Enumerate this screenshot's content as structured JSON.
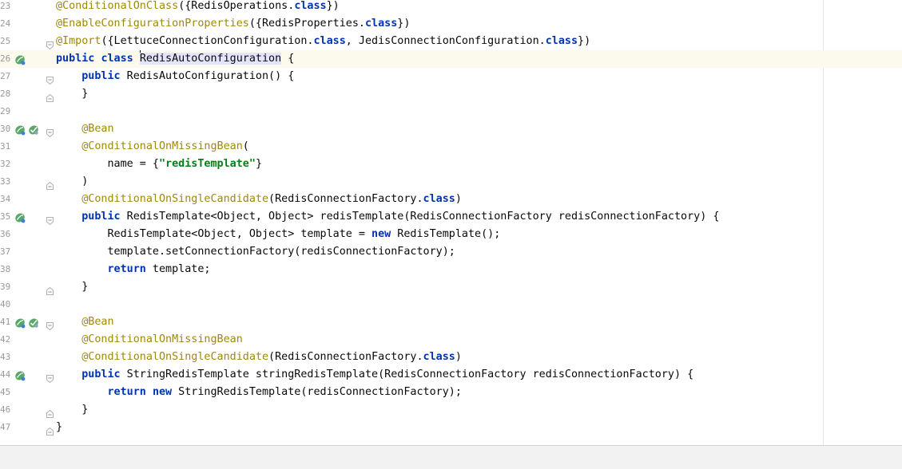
{
  "editor": {
    "lines": [
      {
        "number": "23",
        "segments": [
          [
            "annot",
            "@ConditionalOnClass"
          ],
          [
            "",
            "({RedisOperations."
          ],
          [
            "kw",
            "class"
          ],
          [
            "",
            "})"
          ]
        ]
      },
      {
        "number": "24",
        "segments": [
          [
            "annot",
            "@EnableConfigurationProperties"
          ],
          [
            "",
            "({RedisProperties."
          ],
          [
            "kw",
            "class"
          ],
          [
            "",
            "})"
          ]
        ]
      },
      {
        "number": "25",
        "segments": [
          [
            "annot",
            "@Import"
          ],
          [
            "",
            "({LettuceConnectionConfiguration."
          ],
          [
            "kw",
            "class"
          ],
          [
            "",
            ", JedisConnectionConfiguration."
          ],
          [
            "kw",
            "class"
          ],
          [
            "",
            "})"
          ]
        ]
      },
      {
        "number": "26",
        "current": true,
        "segments": [
          [
            "kw",
            "public"
          ],
          [
            "",
            " "
          ],
          [
            "kw",
            "class"
          ],
          [
            "",
            " "
          ],
          [
            "caret",
            ""
          ],
          [
            "hl",
            "RedisAutoConfiguration"
          ],
          [
            "",
            " {"
          ]
        ]
      },
      {
        "number": "27",
        "segments": [
          [
            "",
            "    "
          ],
          [
            "kw",
            "public"
          ],
          [
            "",
            " RedisAutoConfiguration() {"
          ]
        ]
      },
      {
        "number": "28",
        "segments": [
          [
            "",
            "    }"
          ]
        ]
      },
      {
        "number": "29",
        "segments": []
      },
      {
        "number": "30",
        "segments": [
          [
            "",
            "    "
          ],
          [
            "annot",
            "@Bean"
          ]
        ]
      },
      {
        "number": "31",
        "segments": [
          [
            "",
            "    "
          ],
          [
            "annot",
            "@ConditionalOnMissingBean"
          ],
          [
            "",
            "("
          ]
        ]
      },
      {
        "number": "32",
        "segments": [
          [
            "",
            "        name = {"
          ],
          [
            "str",
            "\"redisTemplate\""
          ],
          [
            "",
            "}"
          ]
        ]
      },
      {
        "number": "33",
        "segments": [
          [
            "",
            "    )"
          ]
        ]
      },
      {
        "number": "34",
        "segments": [
          [
            "",
            "    "
          ],
          [
            "annot",
            "@ConditionalOnSingleCandidate"
          ],
          [
            "",
            "(RedisConnectionFactory."
          ],
          [
            "kw",
            "class"
          ],
          [
            "",
            ")"
          ]
        ]
      },
      {
        "number": "35",
        "segments": [
          [
            "",
            "    "
          ],
          [
            "kw",
            "public"
          ],
          [
            "",
            " RedisTemplate<Object, Object> redisTemplate(RedisConnectionFactory redisConnectionFactory) {"
          ]
        ]
      },
      {
        "number": "36",
        "segments": [
          [
            "",
            "        RedisTemplate<Object, Object> template = "
          ],
          [
            "kw",
            "new"
          ],
          [
            "",
            " RedisTemplate();"
          ]
        ]
      },
      {
        "number": "37",
        "segments": [
          [
            "",
            "        template.setConnectionFactory(redisConnectionFactory);"
          ]
        ]
      },
      {
        "number": "38",
        "segments": [
          [
            "",
            "        "
          ],
          [
            "kw",
            "return"
          ],
          [
            "",
            " template;"
          ]
        ]
      },
      {
        "number": "39",
        "segments": [
          [
            "",
            "    }"
          ]
        ]
      },
      {
        "number": "40",
        "segments": []
      },
      {
        "number": "41",
        "segments": [
          [
            "",
            "    "
          ],
          [
            "annot",
            "@Bean"
          ]
        ]
      },
      {
        "number": "42",
        "segments": [
          [
            "",
            "    "
          ],
          [
            "annot",
            "@ConditionalOnMissingBean"
          ]
        ]
      },
      {
        "number": "43",
        "segments": [
          [
            "",
            "    "
          ],
          [
            "annot",
            "@ConditionalOnSingleCandidate"
          ],
          [
            "",
            "(RedisConnectionFactory."
          ],
          [
            "kw",
            "class"
          ],
          [
            "",
            ")"
          ]
        ]
      },
      {
        "number": "44",
        "segments": [
          [
            "",
            "    "
          ],
          [
            "kw",
            "public"
          ],
          [
            "",
            " StringRedisTemplate stringRedisTemplate(RedisConnectionFactory redisConnectionFactory) {"
          ]
        ]
      },
      {
        "number": "45",
        "segments": [
          [
            "",
            "        "
          ],
          [
            "kw",
            "return"
          ],
          [
            "",
            " "
          ],
          [
            "kw",
            "new"
          ],
          [
            "",
            " StringRedisTemplate(redisConnectionFactory);"
          ]
        ]
      },
      {
        "number": "46",
        "segments": [
          [
            "",
            "    }"
          ]
        ]
      },
      {
        "number": "47",
        "segments": [
          [
            "",
            "}"
          ]
        ]
      }
    ],
    "gutter_icons": [
      {
        "line": "26",
        "icons": [
          "bean-icon"
        ]
      },
      {
        "line": "30",
        "icons": [
          "bean-icon",
          "navigate-icon"
        ]
      },
      {
        "line": "35",
        "icons": [
          "bean-icon"
        ]
      },
      {
        "line": "41",
        "icons": [
          "bean-icon",
          "navigate-icon"
        ]
      },
      {
        "line": "44",
        "icons": [
          "bean-icon"
        ]
      }
    ],
    "fold_markers": [
      {
        "line": "25",
        "kind": "start"
      },
      {
        "line": "27",
        "kind": "start"
      },
      {
        "line": "28",
        "kind": "end"
      },
      {
        "line": "30",
        "kind": "start"
      },
      {
        "line": "33",
        "kind": "end"
      },
      {
        "line": "35",
        "kind": "start"
      },
      {
        "line": "39",
        "kind": "end"
      },
      {
        "line": "41",
        "kind": "start"
      },
      {
        "line": "44",
        "kind": "start"
      },
      {
        "line": "46",
        "kind": "end"
      },
      {
        "line": "47",
        "kind": "end"
      }
    ]
  },
  "colors": {
    "keyword": "#0033b3",
    "annotation": "#9e880d",
    "string": "#067d17",
    "identifier_highlight": "#e4e4ff",
    "current_line": "#fcfaed"
  }
}
